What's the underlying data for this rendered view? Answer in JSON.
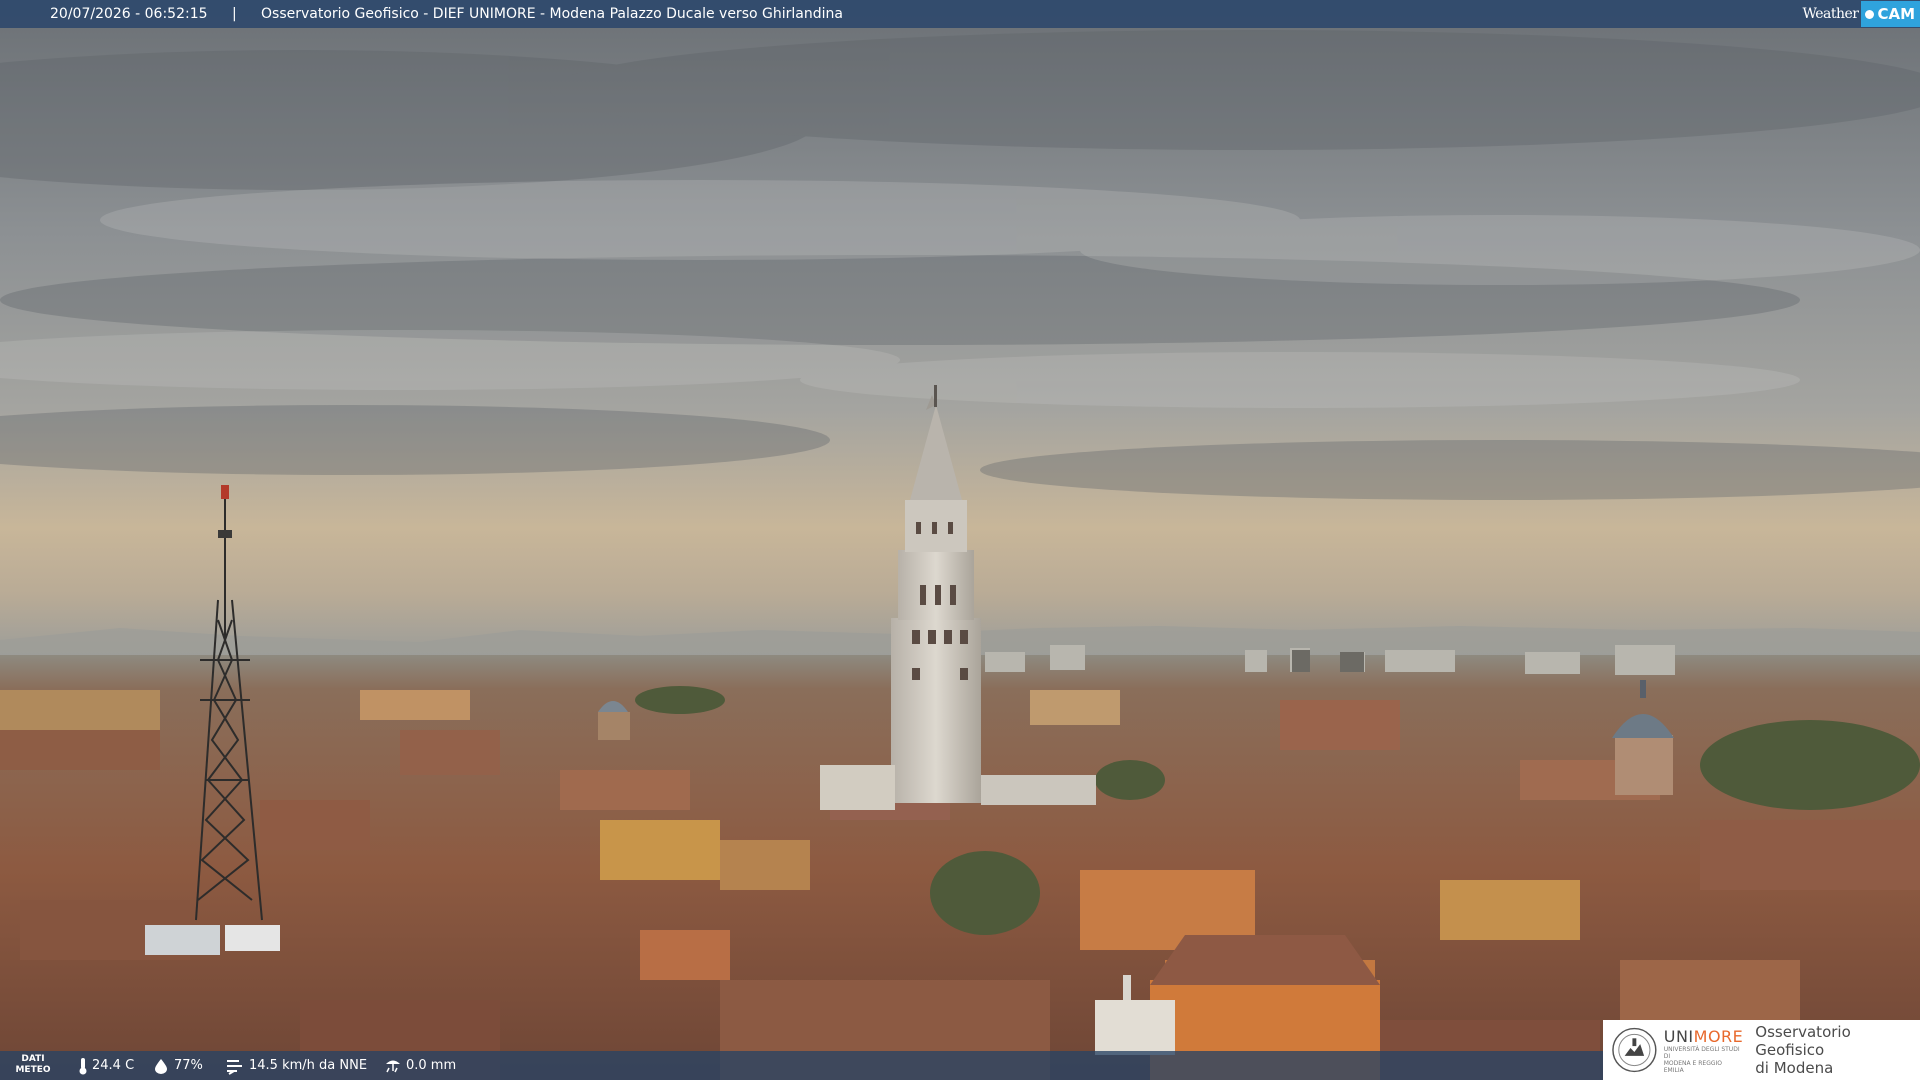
{
  "header": {
    "timestamp": "20/07/2026 - 06:52:15",
    "separator": "|",
    "title": "Osservatorio Geofisico - DIEF UNIMORE - Modena Palazzo Ducale verso Ghirlandina"
  },
  "brand": {
    "weather": "Weather",
    "cam": "CAM",
    "accent": "#2fa3dd"
  },
  "weather": {
    "label_line1": "DATI",
    "label_line2": "METEO",
    "temperature": "24.4 C",
    "humidity": "77%",
    "wind": "14.5 km/h da NNE",
    "rain": "0.0 mm"
  },
  "institution": {
    "name_part1": "UNI",
    "name_part2": "MORE",
    "sub_line1": "UNIVERSITÀ DEGLI STUDI DI",
    "sub_line2": "MODENA E REGGIO EMILIA",
    "obs_line1": "Osservatorio Geofisico",
    "obs_line2": "di Modena"
  },
  "colors": {
    "bar": "#2f496c",
    "unimore_orange": "#e8692d"
  }
}
